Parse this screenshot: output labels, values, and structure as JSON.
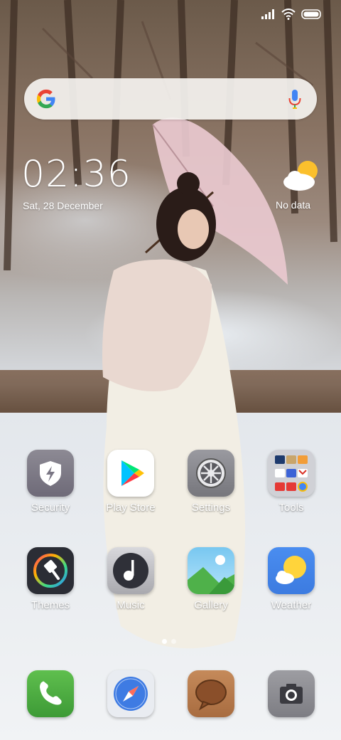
{
  "status_bar": {
    "icons": [
      "signal-icon",
      "wifi-icon",
      "battery-icon"
    ]
  },
  "search": {
    "brand": "google-logo-icon",
    "voice": "microphone-icon"
  },
  "clock": {
    "time": "02:36",
    "date": "Sat, 28 December"
  },
  "weather_widget": {
    "label": "No data",
    "icon": "partly-cloudy-icon"
  },
  "apps": [
    {
      "label": "Security",
      "icon": "shield-lightning-icon"
    },
    {
      "label": "Play Store",
      "icon": "play-store-icon"
    },
    {
      "label": "Settings",
      "icon": "gear-icon"
    },
    {
      "label": "Tools",
      "icon": "folder-icon"
    },
    {
      "label": "Themes",
      "icon": "paintbrush-icon"
    },
    {
      "label": "Music",
      "icon": "music-note-icon"
    },
    {
      "label": "Gallery",
      "icon": "gallery-icon"
    },
    {
      "label": "Weather",
      "icon": "weather-sun-cloud-icon"
    }
  ],
  "dock": [
    {
      "icon": "phone-icon"
    },
    {
      "icon": "browser-compass-icon"
    },
    {
      "icon": "messages-icon"
    },
    {
      "icon": "camera-icon"
    }
  ],
  "page_indicator": {
    "pages": 2,
    "current": 1
  },
  "colors": {
    "google_blue": "#4285F4",
    "google_red": "#EA4335",
    "google_yellow": "#FBBC05",
    "google_green": "#34A853"
  }
}
